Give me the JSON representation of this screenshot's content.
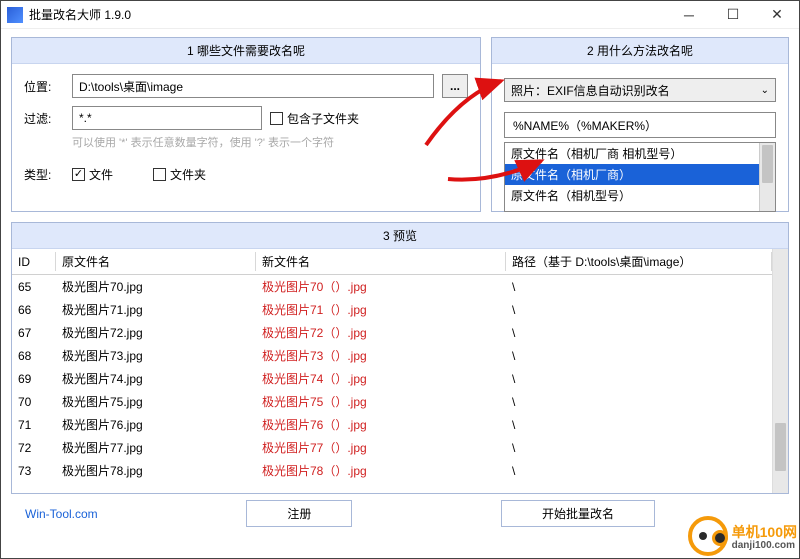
{
  "window": {
    "title": "批量改名大师 1.9.0"
  },
  "panels": {
    "left_title": "1 哪些文件需要改名呢",
    "right_title": "2 用什么方法改名呢",
    "preview_title": "3 预览"
  },
  "form": {
    "location_label": "位置:",
    "location_value": "D:\\tools\\桌面\\image",
    "browse_label": "...",
    "filter_label": "过滤:",
    "filter_value": "*.*",
    "include_sub_label": "包含子文件夹",
    "hint": "可以使用 '*' 表示任意数量字符，使用 '?' 表示一个字符",
    "type_label": "类型:",
    "type_file": "文件",
    "type_folder": "文件夹"
  },
  "method": {
    "dropdown_selected": "照片：EXIF信息自动识别改名",
    "pattern_value": "%NAME%（%MAKER%）",
    "options": [
      "原文件名（相机厂商 相机型号）",
      "原文件名（相机厂商）",
      "原文件名（相机型号）"
    ],
    "selected_index": 1
  },
  "table": {
    "col_id": "ID",
    "col_old": "原文件名",
    "col_new": "新文件名",
    "col_path": "路径（基于 D:\\tools\\桌面\\image）",
    "rows": [
      {
        "id": "65",
        "old": "极光图片70.jpg",
        "new": "极光图片70（）.jpg",
        "path": "\\"
      },
      {
        "id": "66",
        "old": "极光图片71.jpg",
        "new": "极光图片71（）.jpg",
        "path": "\\"
      },
      {
        "id": "67",
        "old": "极光图片72.jpg",
        "new": "极光图片72（）.jpg",
        "path": "\\"
      },
      {
        "id": "68",
        "old": "极光图片73.jpg",
        "new": "极光图片73（）.jpg",
        "path": "\\"
      },
      {
        "id": "69",
        "old": "极光图片74.jpg",
        "new": "极光图片74（）.jpg",
        "path": "\\"
      },
      {
        "id": "70",
        "old": "极光图片75.jpg",
        "new": "极光图片75（）.jpg",
        "path": "\\"
      },
      {
        "id": "71",
        "old": "极光图片76.jpg",
        "new": "极光图片76（）.jpg",
        "path": "\\"
      },
      {
        "id": "72",
        "old": "极光图片77.jpg",
        "new": "极光图片77（）.jpg",
        "path": "\\"
      },
      {
        "id": "73",
        "old": "极光图片78.jpg",
        "new": "极光图片78（）.jpg",
        "path": "\\"
      }
    ]
  },
  "footer": {
    "link": "Win-Tool.com",
    "register": "注册",
    "start": "开始批量改名"
  },
  "watermark": {
    "line1": "单机100网",
    "line2": "danji100.com"
  }
}
